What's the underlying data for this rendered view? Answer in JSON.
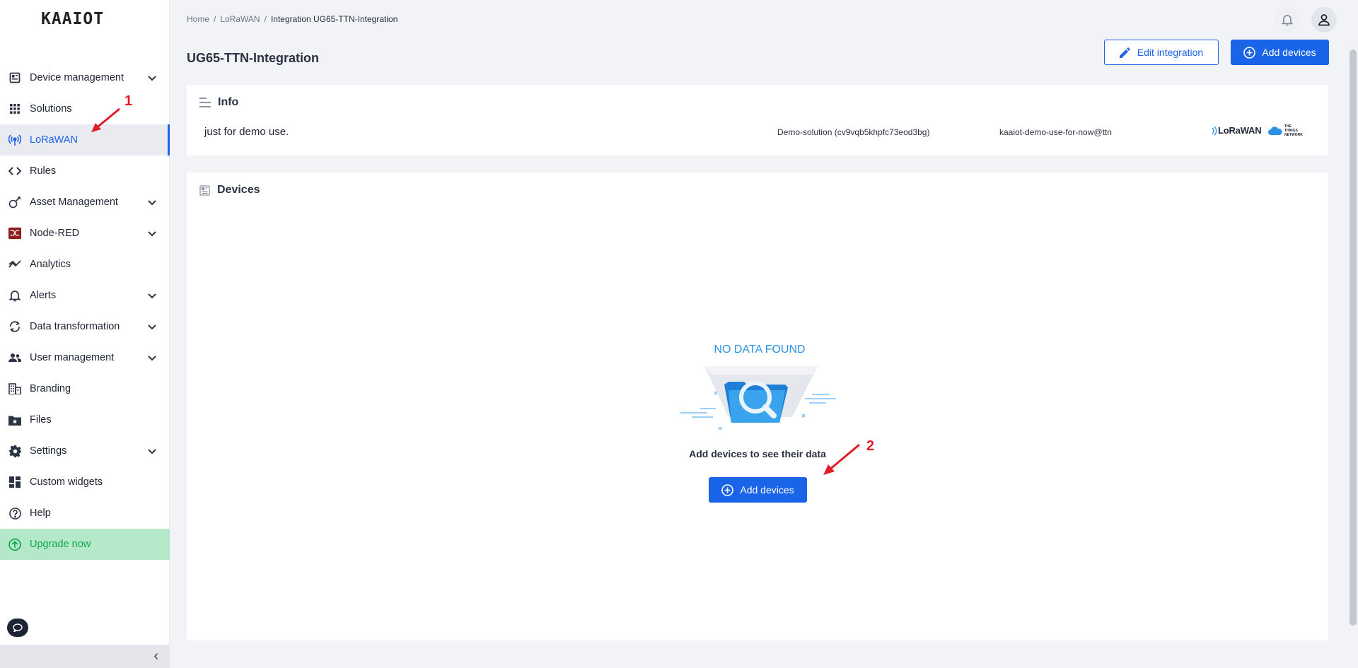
{
  "brand": {
    "logo_text": "KAAIOT"
  },
  "sidebar": {
    "items": [
      {
        "label": "Device management",
        "icon": "device-icon",
        "expandable": true
      },
      {
        "label": "Solutions",
        "icon": "grid-icon",
        "expandable": false
      },
      {
        "label": "LoRaWAN",
        "icon": "antenna-icon",
        "expandable": false,
        "active": true
      },
      {
        "label": "Rules",
        "icon": "code-icon",
        "expandable": false
      },
      {
        "label": "Asset Management",
        "icon": "asset-icon",
        "expandable": true
      },
      {
        "label": "Node-RED",
        "icon": "node-red-icon",
        "expandable": true
      },
      {
        "label": "Analytics",
        "icon": "analytics-icon",
        "expandable": false
      },
      {
        "label": "Alerts",
        "icon": "bell-icon",
        "expandable": true
      },
      {
        "label": "Data transformation",
        "icon": "transform-icon",
        "expandable": true
      },
      {
        "label": "User management",
        "icon": "users-icon",
        "expandable": true
      },
      {
        "label": "Branding",
        "icon": "building-icon",
        "expandable": false
      },
      {
        "label": "Files",
        "icon": "folder-icon",
        "expandable": false
      },
      {
        "label": "Settings",
        "icon": "gear-icon",
        "expandable": true
      },
      {
        "label": "Custom widgets",
        "icon": "widgets-icon",
        "expandable": false
      },
      {
        "label": "Help",
        "icon": "help-icon",
        "expandable": false
      },
      {
        "label": "Upgrade now",
        "icon": "upgrade-icon",
        "expandable": false
      }
    ],
    "collapse_glyph": "‹"
  },
  "breadcrumb": {
    "home": "Home",
    "sep": "/",
    "parent": "LoRaWAN",
    "current": "Integration UG65-TTN-Integration"
  },
  "page": {
    "title": "UG65-TTN-Integration",
    "edit_label": "Edit integration",
    "add_label": "Add devices"
  },
  "info": {
    "heading": "Info",
    "description": "just for demo use.",
    "solution": "Demo-solution (cv9vqb5khpfc73eod3bg)",
    "account": "kaaiot-demo-use-for-now@ttn",
    "lora_logo": "LoRaWAN",
    "ttn_logo": "THE THINGS NETWORK"
  },
  "devices": {
    "heading": "Devices",
    "empty_title": "NO DATA FOUND",
    "empty_text": "Add devices to see their data",
    "add_label": "Add devices"
  },
  "annotations": {
    "one": "1",
    "two": "2"
  },
  "colors": {
    "accent": "#1a64e8",
    "upgrade_bg": "#b3e8c9",
    "upgrade_text": "#13a650",
    "annotation": "#e11d2a"
  }
}
